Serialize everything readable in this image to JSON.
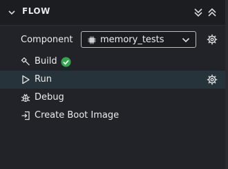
{
  "header": {
    "title": "FLOW"
  },
  "component": {
    "label": "Component",
    "selected": "memory_tests"
  },
  "actions": [
    {
      "label": "Build"
    },
    {
      "label": "Run"
    },
    {
      "label": "Debug"
    },
    {
      "label": "Create Boot Image"
    }
  ],
  "colors": {
    "accent_active_row": "#26333b",
    "success": "#2fa94b"
  }
}
